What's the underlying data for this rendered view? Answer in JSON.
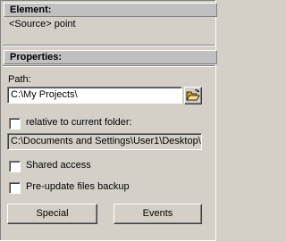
{
  "element": {
    "header": "Element:",
    "value": "<Source> point"
  },
  "properties": {
    "header": "Properties:",
    "path_label": "Path:",
    "path_value": "C:\\My Projects\\",
    "browse_icon": "folder-open-icon",
    "relative_label": "relative to current folder:",
    "relative_checked": false,
    "resolved_path": "C:\\Documents and Settings\\User1\\Desktop\\",
    "shared_label": "Shared access",
    "shared_checked": false,
    "backup_label": "Pre-update files backup",
    "backup_checked": false,
    "special_button": "Special",
    "events_button": "Events"
  }
}
